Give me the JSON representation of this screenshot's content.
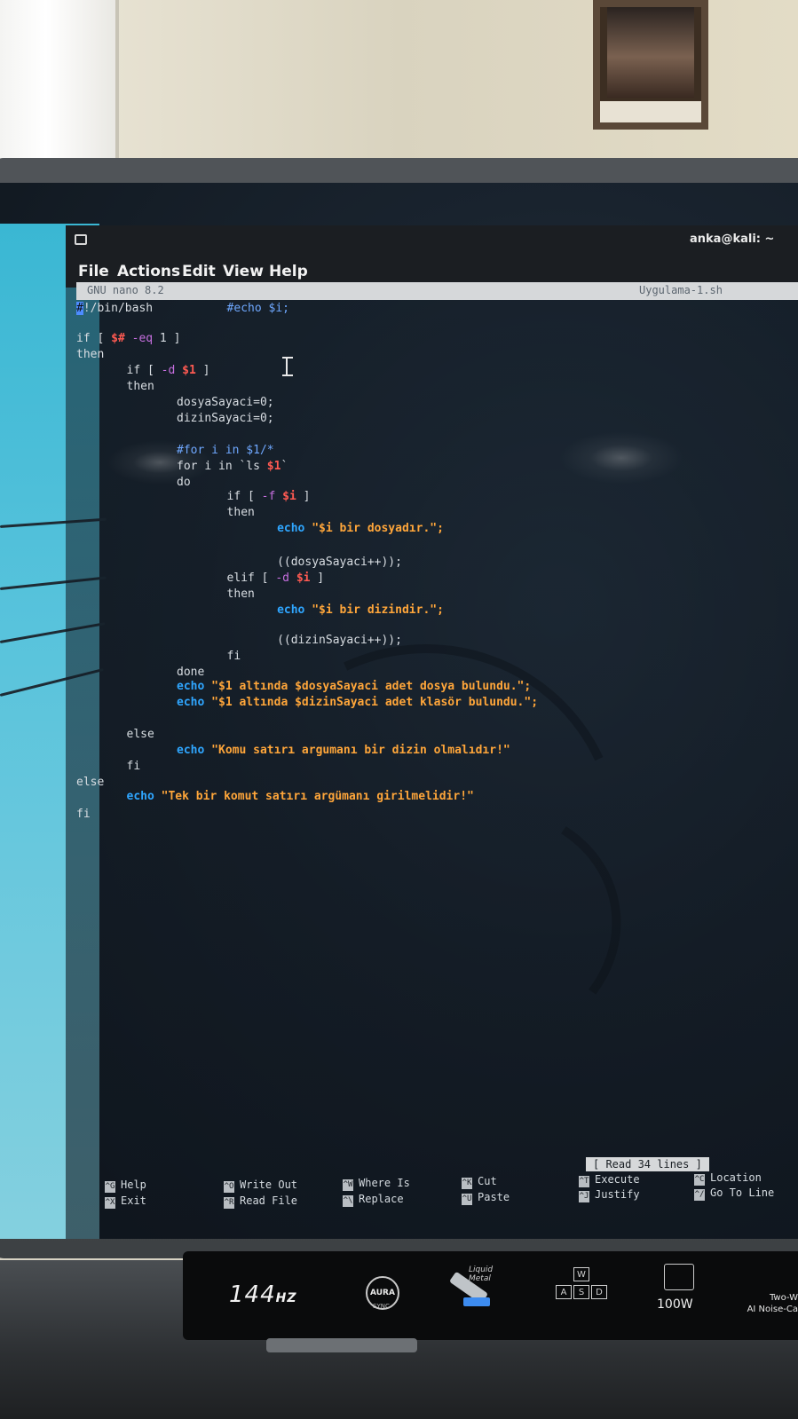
{
  "window": {
    "title": "anka@kali: ~"
  },
  "menu": [
    "File",
    "Actions",
    "Edit",
    "View",
    "Help"
  ],
  "nano": {
    "version": "GNU nano 8.2",
    "filename": "Uygulama-1.sh",
    "status": "[ Read 34 lines ]"
  },
  "code_lines": [
    "#!/bin/bash",
    "",
    "if [ $# -eq 1 ]",
    "then",
    "        if [ -d $1 ]",
    "        then",
    "                dosyaSayaci=0;",
    "                dizinSayaci=0;",
    "",
    "                #for i in $1/*",
    "                for i in `ls $1`",
    "                do",
    "                        #echo $i;",
    "                        if [ -f $i ]",
    "                        then",
    "                                echo \"$i bir dosyadır.\";",
    "",
    "                                ((dosyaSayaci++));",
    "                        elif [ -d $i ]",
    "                        then",
    "                                echo \"$i bir dizindir.\";",
    "",
    "                                ((dizinSayaci++));",
    "                        fi",
    "                done",
    "                echo \"$1 altında $dosyaSayaci adet dosya bulundu.\";",
    "                echo \"$1 altında $dizinSayaci adet klasör bulundu.\";",
    "",
    "        else",
    "                echo \"Komu satırı argumanı bir dizin olmalıdır!\"",
    "        fi",
    "else",
    "        echo \"Tek bir komut satırı argümanı girilmelidir!\"",
    "fi"
  ],
  "shortcuts": [
    {
      "key": "^G",
      "label": "Help"
    },
    {
      "key": "^X",
      "label": "Exit"
    },
    {
      "key": "^O",
      "label": "Write Out"
    },
    {
      "key": "^R",
      "label": "Read File"
    },
    {
      "key": "^W",
      "label": "Where Is"
    },
    {
      "key": "^\\",
      "label": "Replace"
    },
    {
      "key": "^K",
      "label": "Cut"
    },
    {
      "key": "^U",
      "label": "Paste"
    },
    {
      "key": "^T",
      "label": "Execute"
    },
    {
      "key": "^J",
      "label": "Justify"
    },
    {
      "key": "^C",
      "label": "Location"
    },
    {
      "key": "^/",
      "label": "Go To Line"
    }
  ],
  "laptop_badges": {
    "refresh": "144",
    "refresh_unit": "HZ",
    "aura": "AURA",
    "aura_sub": "SYNC",
    "liquid_metal": "Liquid Metal",
    "keys": [
      "W",
      "A",
      "S",
      "D"
    ],
    "power": "100W",
    "noise": "Two-W",
    "noise_sub": "AI Noise-Ca"
  },
  "colors": {
    "keyword": "#d8dde2",
    "variable": "#ff5a52",
    "option": "#c76fe0",
    "comment": "#6fa8ff",
    "echo": "#2fa6ff",
    "string": "#ffa63a",
    "cursor": "#4d8cff"
  }
}
